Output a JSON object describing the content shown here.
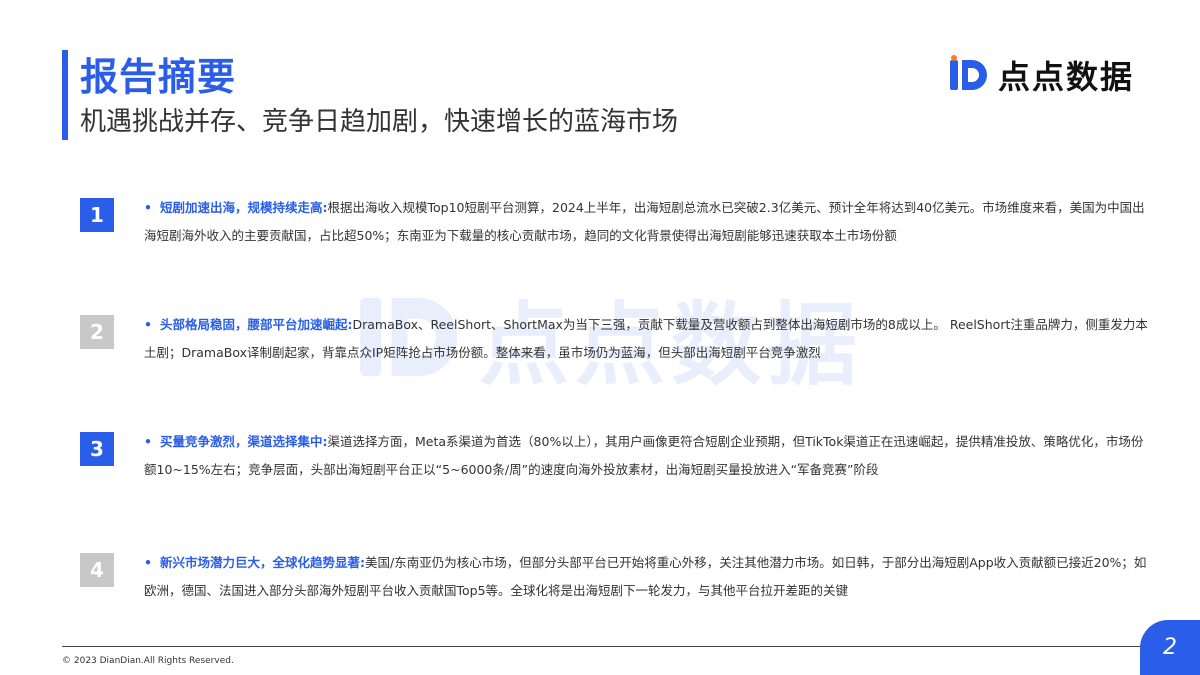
{
  "header": {
    "title": "报告摘要",
    "subtitle": "机遇挑战并存、竞争日趋加剧，快速增长的蓝海市场"
  },
  "logo": {
    "text": "点点数据",
    "icon": "diandian-logo-icon"
  },
  "watermark": {
    "text": "点点数据"
  },
  "items": [
    {
      "number": "1",
      "bullet": "•",
      "lead": "短剧加速出海，规模持续走高:",
      "body": "根据出海收入规模Top10短剧平台测算，2024上半年，出海短剧总流水已突破2.3亿美元、预计全年将达到40亿美元。市场维度来看，美国为中国出海短剧海外收入的主要贡献国，占比超50%；东南亚为下载量的核心贡献市场，趋同的文化背景使得出海短剧能够迅速获取本土市场份额"
    },
    {
      "number": "2",
      "bullet": "•",
      "lead": "头部格局稳固，腰部平台加速崛起:",
      "body": "DramaBox、ReelShort、ShortMax为当下三强，贡献下载量及营收额占到整体出海短剧市场的8成以上。 ReelShort注重品牌力，侧重发力本土剧；DramaBox译制剧起家，背靠点众IP矩阵抢占市场份额。整体来看，虽市场仍为蓝海，但头部出海短剧平台竞争激烈"
    },
    {
      "number": "3",
      "bullet": "•",
      "lead": "买量竞争激烈，渠道选择集中:",
      "body": "渠道选择方面，Meta系渠道为首选（80%以上），其用户画像更符合短剧企业预期，但TikTok渠道正在迅速崛起，提供精准投放、策略优化，市场份额10~15%左右；竞争层面，头部出海短剧平台正以“5~6000条/周”的速度向海外投放素材，出海短剧买量投放进入“军备竞赛”阶段"
    },
    {
      "number": "4",
      "bullet": "•",
      "lead": "新兴市场潜力巨大，全球化趋势显著:",
      "body": "美国/东南亚仍为核心市场，但部分头部平台已开始将重心外移，关注其他潜力市场。如日韩，于部分出海短剧App收入贡献额已接近20%；如欧洲，德国、法国进入部分头部海外短剧平台收入贡献国Top5等。全球化将是出海短剧下一轮发力，与其他平台拉开差距的关键"
    }
  ],
  "footer": {
    "copyright": "© 2023 DianDian.All Rights Reserved.",
    "page_number": "2"
  },
  "colors": {
    "accent": "#2a5ee8",
    "number_grey": "#c8c8c8"
  }
}
